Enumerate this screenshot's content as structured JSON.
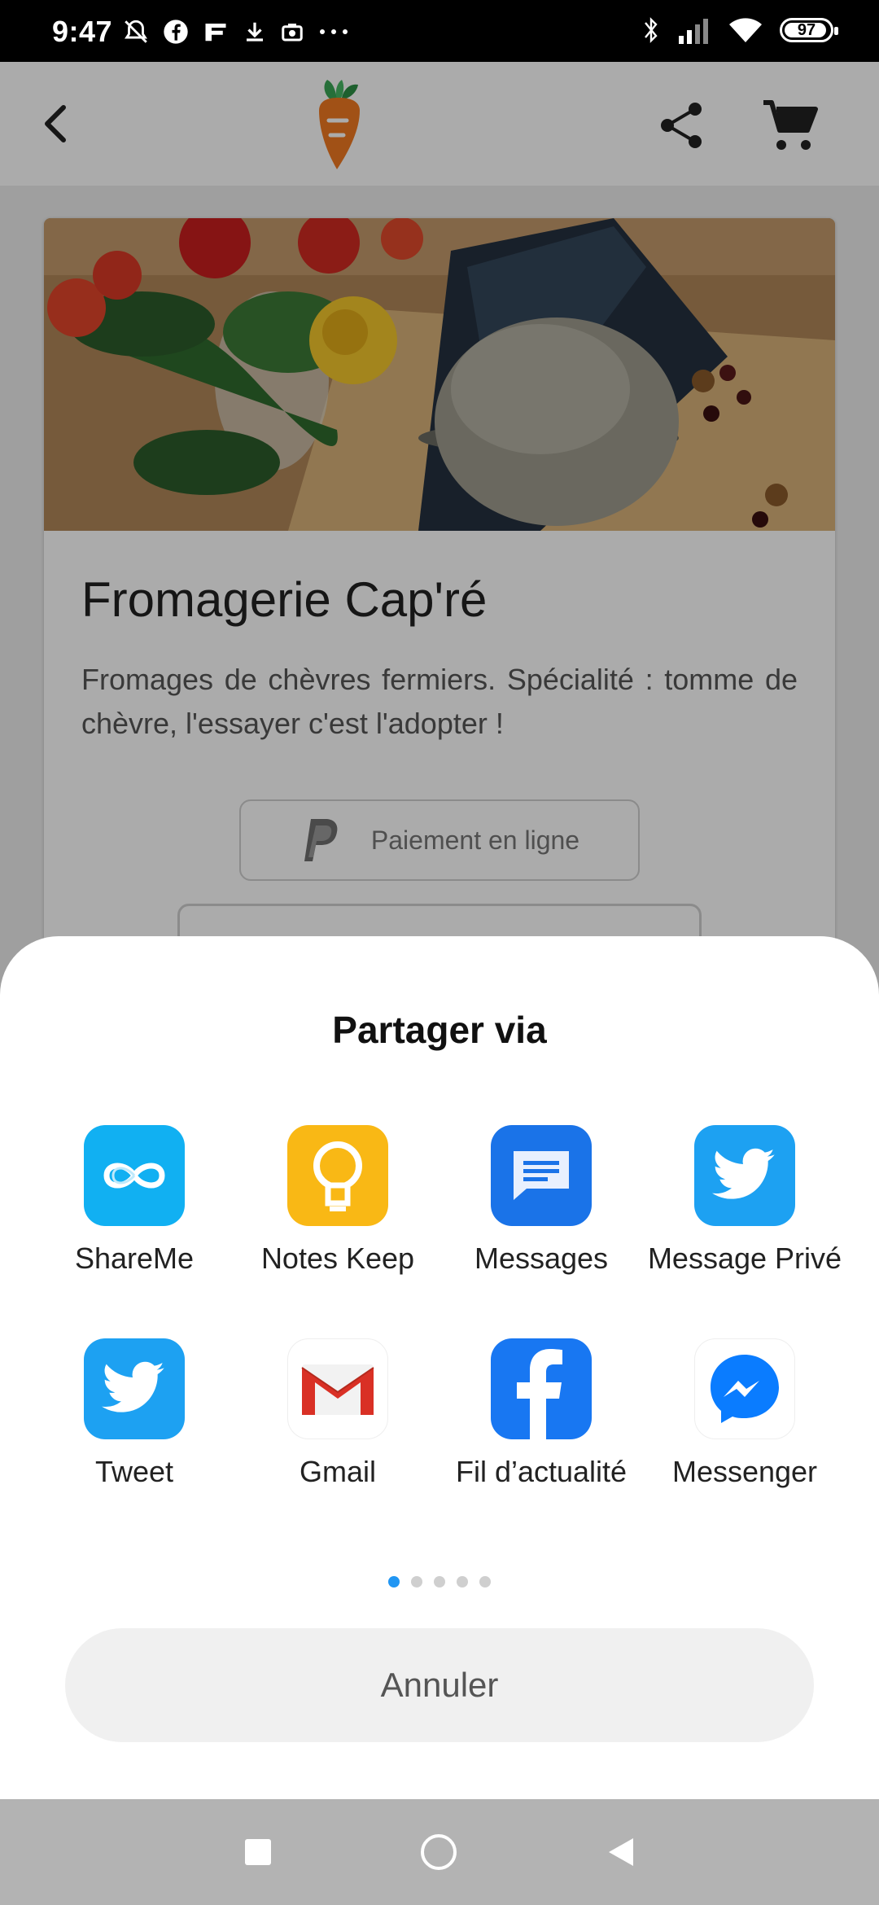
{
  "status_bar": {
    "time": "9:47",
    "battery": "97",
    "left_icons": [
      "mute-bell-icon",
      "facebook-icon",
      "f-app-icon",
      "download-icon",
      "camera-icon",
      "more-dots-icon"
    ],
    "right_icons": [
      "bluetooth-icon",
      "signal-icon",
      "wifi-icon",
      "battery-icon"
    ]
  },
  "app_bar": {
    "icons": [
      "back-arrow-icon",
      "carrot-logo-icon",
      "share-icon",
      "cart-icon"
    ]
  },
  "shop": {
    "title": "Fromagerie Cap'ré",
    "description": "Fromages de chèvres fermiers. Spécialité : tomme de chèvre, l'essayer c'est l'adopter !",
    "pay_button_label": "Paiement en ligne"
  },
  "share_sheet": {
    "title": "Partager via",
    "apps": [
      {
        "label": "ShareMe",
        "icon": "shareme-icon",
        "color": "#11b0f2"
      },
      {
        "label": "Notes Keep",
        "icon": "keep-bulb-icon",
        "color": "#f9b815"
      },
      {
        "label": "Messages",
        "icon": "messages-icon",
        "color": "#1a73e8"
      },
      {
        "label": "Message Privé",
        "icon": "twitter-bird-icon",
        "color": "#1da1f2"
      },
      {
        "label": "Tweet",
        "icon": "twitter-bird-icon",
        "color": "#1da1f2"
      },
      {
        "label": "Gmail",
        "icon": "gmail-icon",
        "color": "#d93025"
      },
      {
        "label": "Fil d’actualité",
        "icon": "facebook-icon",
        "color": "#1877f2"
      },
      {
        "label": "Messenger",
        "icon": "messenger-icon",
        "color": "#0a7cff"
      }
    ],
    "page_count": 5,
    "current_page": 1,
    "cancel_label": "Annuler"
  },
  "nav_bar": {
    "icons": [
      "recent-apps-square-icon",
      "home-circle-icon",
      "back-triangle-icon"
    ]
  }
}
